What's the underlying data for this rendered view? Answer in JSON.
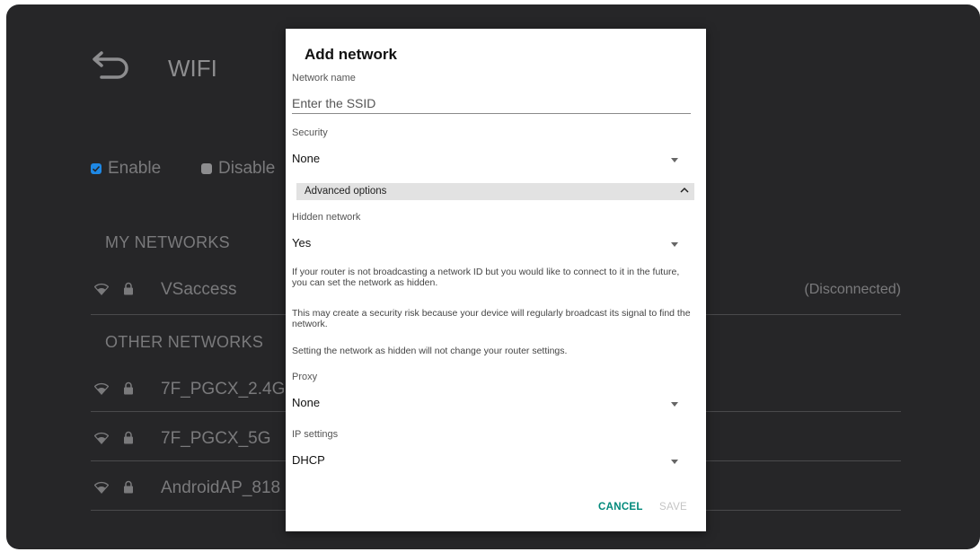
{
  "page": {
    "title": "WIFI",
    "enable_label": "Enable",
    "disable_label": "Disable",
    "my_networks_label": "MY NETWORKS",
    "other_networks_label": "OTHER NETWORKS",
    "my_networks": [
      {
        "ssid": "VSaccess",
        "status": "(Disconnected)"
      }
    ],
    "other_networks": [
      {
        "ssid": "7F_PGCX_2.4G"
      },
      {
        "ssid": "7F_PGCX_5G"
      },
      {
        "ssid": "AndroidAP_818"
      }
    ],
    "accent_color": "#1e88e5"
  },
  "dialog": {
    "title": "Add network",
    "network_name_label": "Network name",
    "network_name_placeholder": "Enter the SSID",
    "security_label": "Security",
    "security_value": "None",
    "advanced_options_label": "Advanced options",
    "hidden_network_label": "Hidden network",
    "hidden_network_value": "Yes",
    "hidden_help_1": "If your router is not broadcasting a network ID but you would like to connect to it in the future, you can set the network as hidden.",
    "hidden_help_2": "This may create a security risk because your device will regularly broadcast its signal to find the network.",
    "hidden_help_3": "Setting the network as hidden will not change your router settings.",
    "proxy_label": "Proxy",
    "proxy_value": "None",
    "ip_settings_label": "IP settings",
    "ip_settings_value": "DHCP",
    "cancel_label": "CANCEL",
    "save_label": "SAVE",
    "cancel_color": "#00897b",
    "save_disabled_color": "#c4c4c4"
  }
}
